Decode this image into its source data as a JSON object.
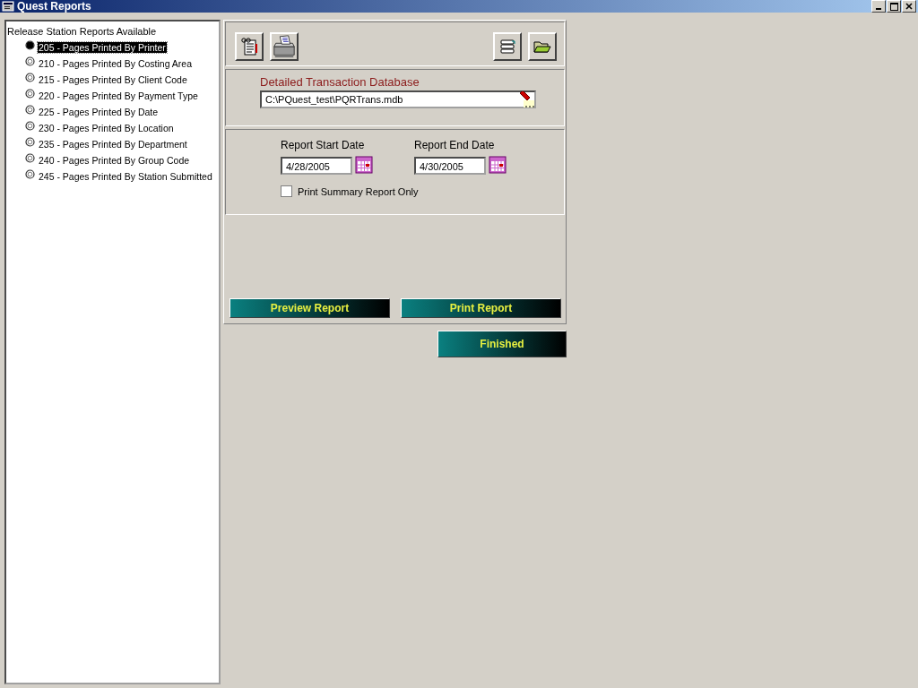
{
  "window": {
    "title": "Quest Reports"
  },
  "reports": {
    "heading": "Release Station Reports Available",
    "items": [
      {
        "label": "205 - Pages Printed By Printer",
        "selected": true
      },
      {
        "label": "210 - Pages Printed By Costing Area",
        "selected": false
      },
      {
        "label": "215 - Pages Printed By Client Code",
        "selected": false
      },
      {
        "label": "220 - Pages Printed By Payment Type",
        "selected": false
      },
      {
        "label": "225 - Pages Printed By Date",
        "selected": false
      },
      {
        "label": "230 - Pages Printed By Location",
        "selected": false
      },
      {
        "label": "235 - Pages Printed By Department",
        "selected": false
      },
      {
        "label": "240 - Pages Printed By Group Code",
        "selected": false
      },
      {
        "label": "245 - Pages Printed By Station Submitted",
        "selected": false
      }
    ]
  },
  "database": {
    "label": "Detailed Transaction Database",
    "value": "C:\\PQuest_test\\PQRTrans.mdb"
  },
  "dates": {
    "start_label": "Report Start Date",
    "start_value": "4/28/2005",
    "end_label": "Report End Date",
    "end_value": "4/30/2005"
  },
  "summary_only": {
    "label": "Print Summary Report Only",
    "checked": false
  },
  "buttons": {
    "preview": "Preview Report",
    "print": "Print Report",
    "finished": "Finished"
  }
}
